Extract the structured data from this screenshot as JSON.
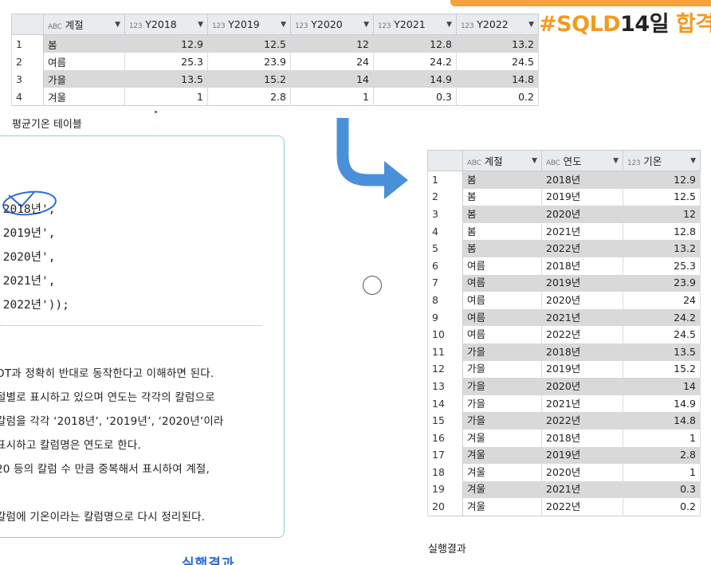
{
  "badge": {
    "hash": "#SQLD",
    "num": "14",
    "il": "일",
    "hap": "합격"
  },
  "pivot_table": {
    "headers": [
      {
        "type": "ABC",
        "label": "계절"
      },
      {
        "type": "123",
        "label": "Y2018"
      },
      {
        "type": "123",
        "label": "Y2019"
      },
      {
        "type": "123",
        "label": "Y2020"
      },
      {
        "type": "123",
        "label": "Y2021"
      },
      {
        "type": "123",
        "label": "Y2022"
      }
    ],
    "rows": [
      {
        "n": "1",
        "season": "봄",
        "v": [
          "12.9",
          "12.5",
          "12",
          "12.8",
          "13.2"
        ]
      },
      {
        "n": "2",
        "season": "여름",
        "v": [
          "25.3",
          "23.9",
          "24",
          "24.2",
          "24.5"
        ]
      },
      {
        "n": "3",
        "season": "가을",
        "v": [
          "13.5",
          "15.2",
          "14",
          "14.9",
          "14.8"
        ]
      },
      {
        "n": "4",
        "season": "겨울",
        "v": [
          "1",
          "2.8",
          "1",
          "0.3",
          "0.2"
        ]
      }
    ],
    "caption": "평균기온 테이블"
  },
  "result_table": {
    "headers": [
      {
        "type": "ABC",
        "label": "계절"
      },
      {
        "type": "ABC",
        "label": "연도"
      },
      {
        "type": "123",
        "label": "기온"
      }
    ],
    "rows": [
      {
        "n": "1",
        "season": "봄",
        "year": "2018년",
        "temp": "12.9"
      },
      {
        "n": "2",
        "season": "봄",
        "year": "2019년",
        "temp": "12.5"
      },
      {
        "n": "3",
        "season": "봄",
        "year": "2020년",
        "temp": "12"
      },
      {
        "n": "4",
        "season": "봄",
        "year": "2021년",
        "temp": "12.8"
      },
      {
        "n": "5",
        "season": "봄",
        "year": "2022년",
        "temp": "13.2"
      },
      {
        "n": "6",
        "season": "여름",
        "year": "2018년",
        "temp": "25.3"
      },
      {
        "n": "7",
        "season": "여름",
        "year": "2019년",
        "temp": "23.9"
      },
      {
        "n": "8",
        "season": "여름",
        "year": "2020년",
        "temp": "24"
      },
      {
        "n": "9",
        "season": "여름",
        "year": "2021년",
        "temp": "24.2"
      },
      {
        "n": "10",
        "season": "여름",
        "year": "2022년",
        "temp": "24.5"
      },
      {
        "n": "11",
        "season": "가을",
        "year": "2018년",
        "temp": "13.5"
      },
      {
        "n": "12",
        "season": "가을",
        "year": "2019년",
        "temp": "15.2"
      },
      {
        "n": "13",
        "season": "가을",
        "year": "2020년",
        "temp": "14"
      },
      {
        "n": "14",
        "season": "가을",
        "year": "2021년",
        "temp": "14.9"
      },
      {
        "n": "15",
        "season": "가을",
        "year": "2022년",
        "temp": "14.8"
      },
      {
        "n": "16",
        "season": "겨울",
        "year": "2018년",
        "temp": "1"
      },
      {
        "n": "17",
        "season": "겨울",
        "year": "2019년",
        "temp": "2.8"
      },
      {
        "n": "18",
        "season": "겨울",
        "year": "2020년",
        "temp": "1"
      },
      {
        "n": "19",
        "season": "겨울",
        "year": "2021년",
        "temp": "0.3"
      },
      {
        "n": "20",
        "season": "겨울",
        "year": "2022년",
        "temp": "0.2"
      }
    ],
    "caption": "실행결과"
  },
  "code_lines": [
    "'2018년',",
    "'2019년',",
    "'2020년',",
    "'2021년',",
    "'2022년'));"
  ],
  "prose_lines": [
    "OT과 정확히 반대로 동작한다고 이해하면 된다.",
    "절별로 표시하고 있으며 연도는 각각의 칼럼으로",
    "칼럼을 각각 ‘2018년’, ‘2019년’, ‘2020년’이라",
    "표시하고 칼럼명은 연도로 한다.",
    "20 등의 칼럼 수 만큼 중복해서 표시하여 계절,",
    "",
    "칼럼에 기온이라는 칼럼명으로 다시 정리된다."
  ],
  "colors": {
    "accent": "#f39a1e",
    "arrow": "#4a90d9",
    "box_border": "#8fcfd8",
    "row_shade": "#d9d9d9",
    "pen": "#2c6cd6"
  }
}
